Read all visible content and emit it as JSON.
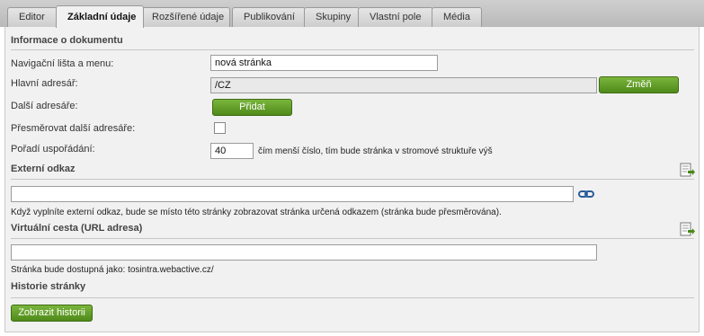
{
  "tabs": [
    {
      "label": "Editor"
    },
    {
      "label": "Základní údaje"
    },
    {
      "label": "Rozšířené údaje"
    },
    {
      "label": "Publikování"
    },
    {
      "label": "Skupiny"
    },
    {
      "label": "Vlastní pole"
    },
    {
      "label": "Média"
    }
  ],
  "active_tab": "Základní údaje",
  "document_info": {
    "title": "Informace o dokumentu",
    "nav_label": "Navigační lišta a menu:",
    "nav_value": "nová stránka",
    "main_dir_label": "Hlavní adresář:",
    "main_dir_value": "/CZ",
    "change_button": "Změň",
    "other_dirs_label": "Další adresáře:",
    "add_button": "Přidat",
    "redirect_label": "Přesměrovat další adresáře:",
    "redirect_checked": false,
    "order_label": "Pořadí uspořádání:",
    "order_value": "40",
    "order_hint": "čím menší číslo, tím bude stránka v stromové struktuře výš"
  },
  "external_link": {
    "title": "Externí odkaz",
    "value": "",
    "hint": "Když vyplníte externí odkaz, bude se místo této stránky zobrazovat stránka určená odkazem (stránka bude přesměrována).",
    "icons": [
      "document-arrow-icon",
      "link-icon"
    ]
  },
  "virtual_path": {
    "title": "Virtuální cesta (URL adresa)",
    "value": "",
    "hint": "Stránka bude dostupná jako: tosintra.webactive.cz/",
    "icons": [
      "document-arrow-icon"
    ]
  },
  "history": {
    "title": "Historie stránky",
    "button": "Zobrazit historii"
  }
}
